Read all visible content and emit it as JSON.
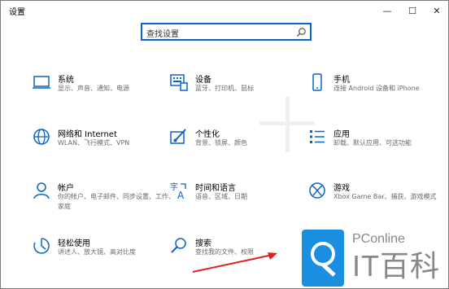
{
  "window": {
    "title": "设置",
    "controls": {
      "minimize": "—",
      "maximize": "☐",
      "close": "✕"
    }
  },
  "search": {
    "placeholder": "查找设置"
  },
  "tiles": [
    {
      "name": "系统",
      "desc": "显示、声音、通知、电源",
      "icon": "laptop-icon"
    },
    {
      "name": "设备",
      "desc": "蓝牙、打印机、鼠标",
      "icon": "keyboard-device-icon"
    },
    {
      "name": "手机",
      "desc": "连接 Android 设备和 iPhone",
      "icon": "phone-icon"
    },
    {
      "name": "网络和 Internet",
      "desc": "WLAN、飞行模式、VPN",
      "icon": "globe-icon"
    },
    {
      "name": "个性化",
      "desc": "背景、锁屏、颜色",
      "icon": "paintbrush-icon"
    },
    {
      "name": "应用",
      "desc": "卸载、默认应用、可选功能",
      "icon": "apps-list-icon"
    },
    {
      "name": "帐户",
      "desc": "你的帐户、电子邮件、同步设置、工作、家庭",
      "icon": "person-icon"
    },
    {
      "name": "时间和语言",
      "desc": "语音、区域、日期",
      "icon": "time-language-icon"
    },
    {
      "name": "游戏",
      "desc": "Xbox Game Bar、捕获、游戏模式",
      "icon": "xbox-icon"
    },
    {
      "name": "轻松使用",
      "desc": "讲述人、放大镜、高对比度",
      "icon": "ease-of-access-icon"
    },
    {
      "name": "搜索",
      "desc": "查找我的文件、权限",
      "icon": "magnifier-icon"
    }
  ],
  "watermark": {
    "brand": "PConline",
    "logo": "IT百科"
  },
  "colors": {
    "accent": "#0a64c8",
    "arrow": "#e02020"
  }
}
